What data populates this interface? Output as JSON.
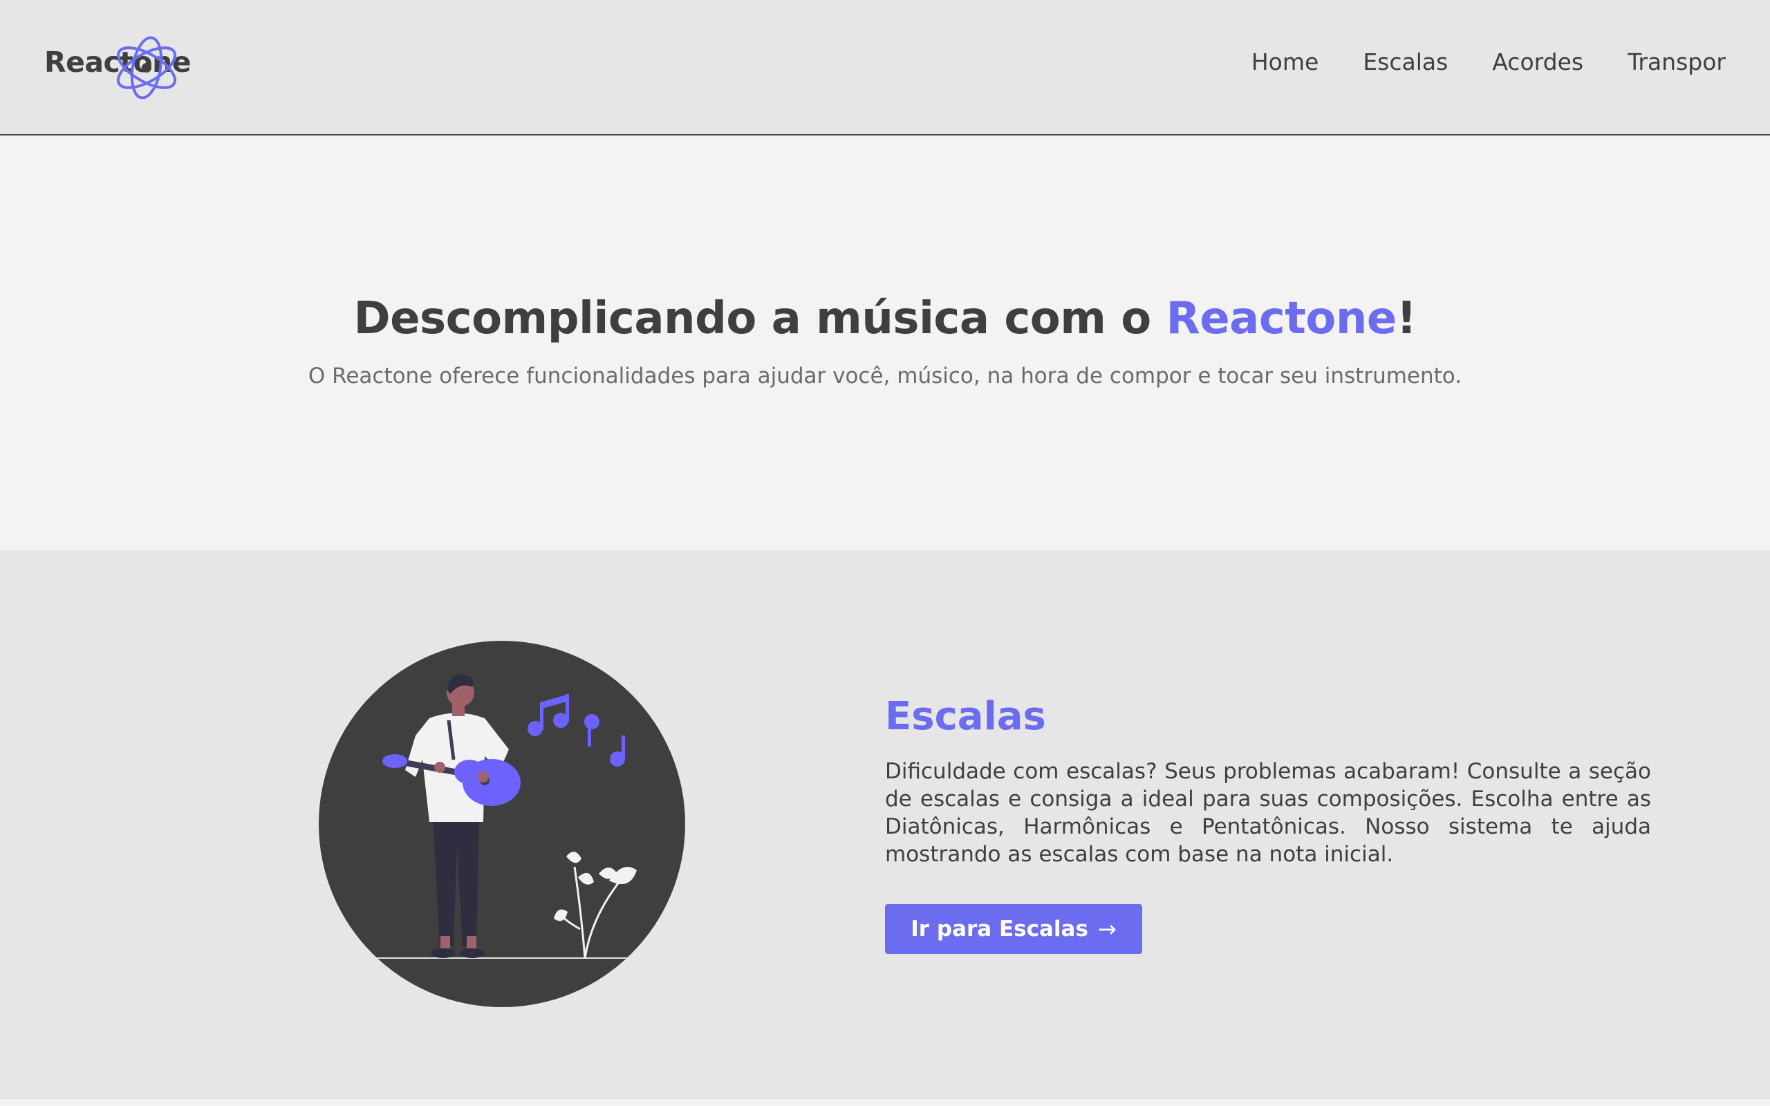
{
  "header": {
    "logo_text": "Reactone",
    "nav": [
      {
        "label": "Home"
      },
      {
        "label": "Escalas"
      },
      {
        "label": "Acordes"
      },
      {
        "label": "Transpor"
      }
    ]
  },
  "hero": {
    "title_prefix": "Descomplicando a música com o ",
    "title_accent": "Reactone",
    "title_suffix": "!",
    "subtitle": "O Reactone oferece funcionalidades para ajudar você, músico, na hora de compor e tocar seu instrumento."
  },
  "section": {
    "title": "Escalas",
    "text": "Dificuldade com escalas? Seus problemas acabaram! Consulte a seção de escalas e consiga a ideal para suas composições. Escolha entre as Diatônicas, Harmônicas e Pentatônicas. Nosso sistema te ajuda mostrando as escalas com base na nota inicial.",
    "button_label": "Ir para Escalas",
    "button_icon": "arrow-right-icon",
    "illustration": "guitarist-illustration"
  },
  "colors": {
    "accent": "#6c6cf0",
    "text_dark": "#3f3f3f",
    "header_bg": "#e6e6e6",
    "hero_bg": "#f3f3f3"
  }
}
